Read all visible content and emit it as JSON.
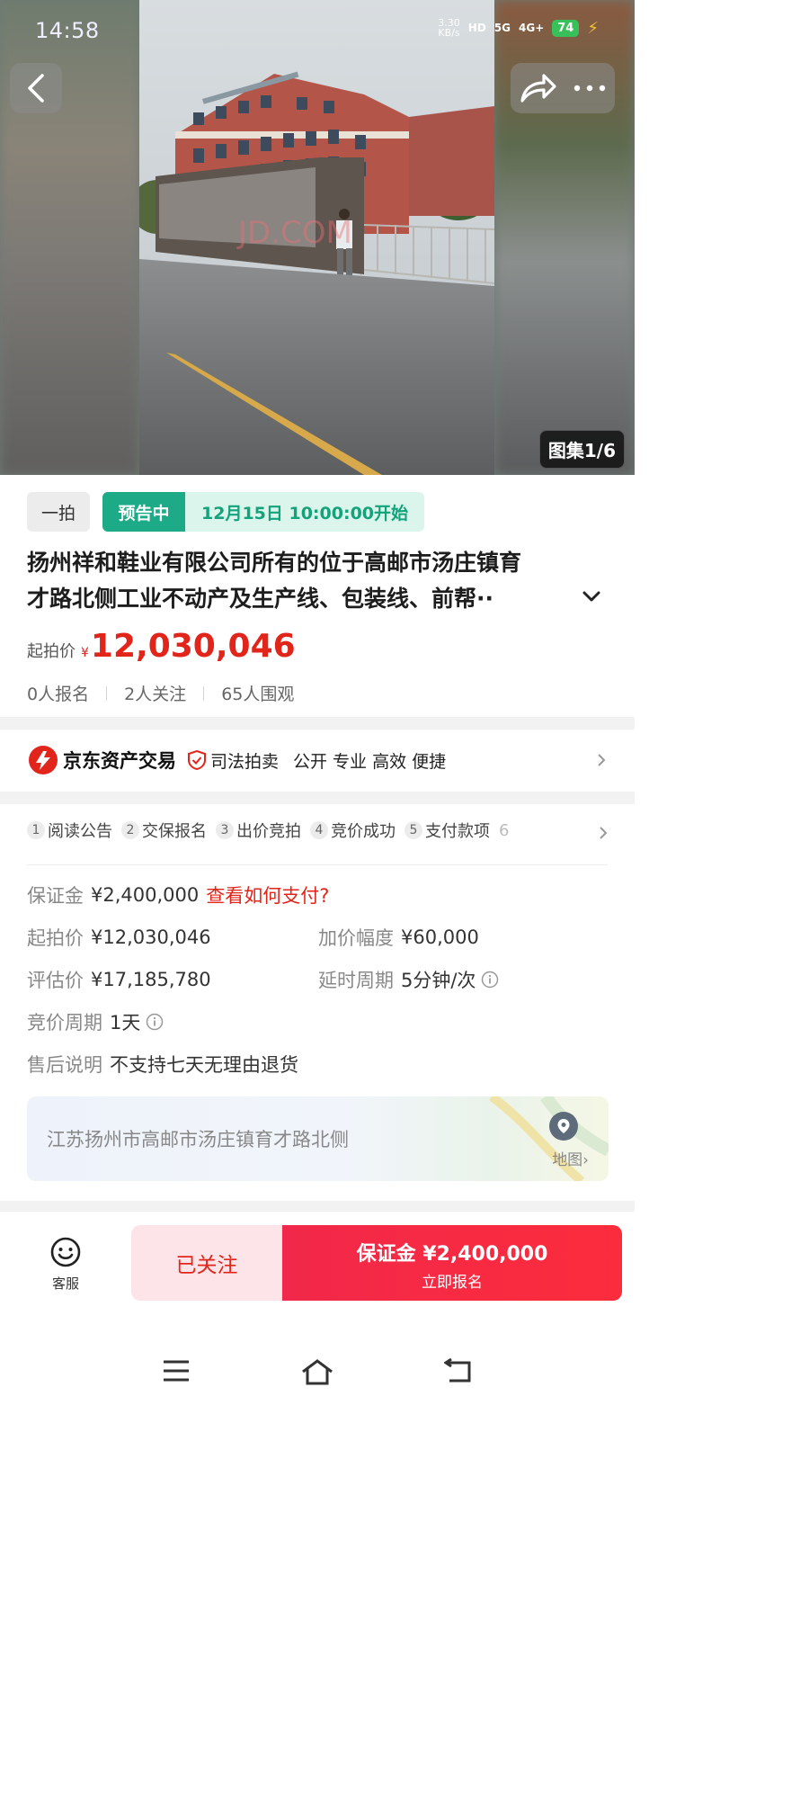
{
  "status_bar": {
    "time": "14:58",
    "net_speed_value": "3.30",
    "net_speed_unit": "KB/s",
    "hd_label": "HD",
    "network_5g": "5G",
    "network_4g": "4G+",
    "battery": "74"
  },
  "gallery": {
    "badge": "图集1/6",
    "watermark": "JD.COM"
  },
  "auction": {
    "round_tag": "一拍",
    "status_tag": "预告中",
    "start_time": "12月15日 10:00:00开始",
    "title_line1": "扬州祥和鞋业有限公司所有的位于高邮市汤庄镇育",
    "title_line2": "才路北侧工业不动产及生产线、包装线、前帮··",
    "starting_price_label": "起拍价",
    "currency_symbol": "¥",
    "starting_price": "12,030,046",
    "registered": "0人报名",
    "followers": "2人关注",
    "viewers": "65人围观"
  },
  "platform": {
    "name": "京东资产交易",
    "tag": "司法拍卖",
    "slogan": "公开 专业 高效 便捷"
  },
  "steps": [
    {
      "num": "1",
      "label": "阅读公告"
    },
    {
      "num": "2",
      "label": "交保报名"
    },
    {
      "num": "3",
      "label": "出价竞拍"
    },
    {
      "num": "4",
      "label": "竞价成功"
    },
    {
      "num": "5",
      "label": "支付款项"
    },
    {
      "num": "6",
      "label": ""
    }
  ],
  "details": {
    "deposit_label": "保证金",
    "deposit_value": "¥2,400,000",
    "deposit_link": "查看如何支付?",
    "start_label": "起拍价",
    "start_value": "¥12,030,046",
    "increment_label": "加价幅度",
    "increment_value": "¥60,000",
    "appraisal_label": "评估价",
    "appraisal_value": "¥17,185,780",
    "delay_label": "延时周期",
    "delay_value": "5分钟/次",
    "cycle_label": "竞价周期",
    "cycle_value": "1天",
    "aftersale_label": "售后说明",
    "aftersale_value": "不支持七天无理由退货"
  },
  "address": {
    "text": "江苏扬州市高邮市汤庄镇育才路北侧",
    "map_label": "地图›"
  },
  "bottom_bar": {
    "service_label": "客服",
    "follow_label": "已关注",
    "signup_main": "保证金 ¥2,400,000",
    "signup_sub": "立即报名"
  },
  "colors": {
    "accent_red": "#e1251b",
    "status_green": "#1cab86",
    "signup_red": "#f2284a"
  }
}
